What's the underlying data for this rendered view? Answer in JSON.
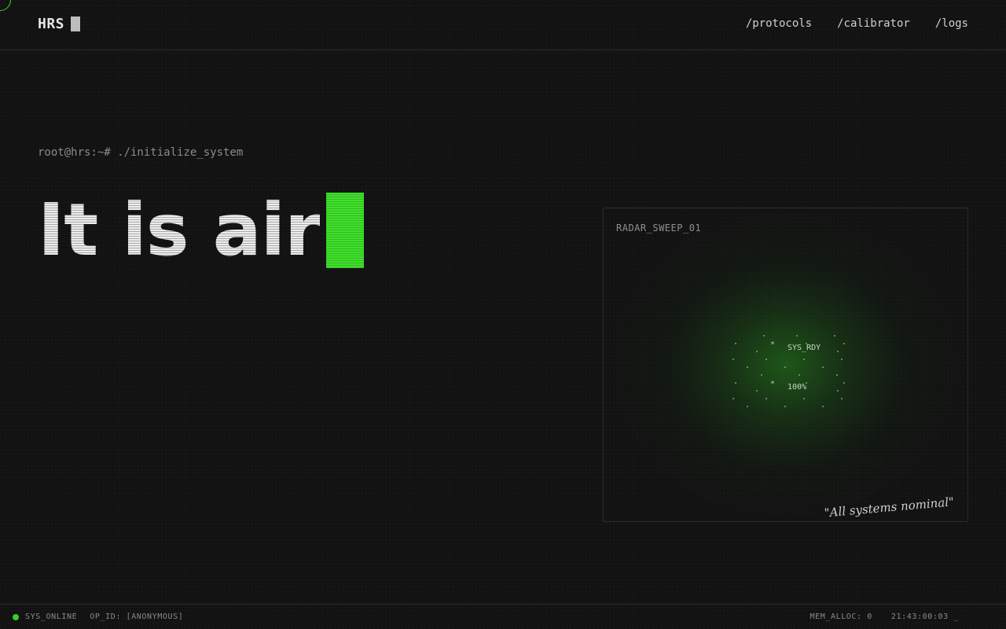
{
  "brand": {
    "name": "HRS"
  },
  "nav": {
    "items": [
      "/protocols",
      "/calibrator",
      "/logs"
    ]
  },
  "terminal": {
    "prompt": "root@hrs:~# ./initialize_system"
  },
  "hero": {
    "headline": "It is air"
  },
  "radar": {
    "label": "RADAR_SWEEP_01",
    "status_text": "SYS_RDY",
    "percent_text": "100%",
    "quote": "\"All systems nominal\""
  },
  "status": {
    "online": "SYS_ONLINE",
    "op_id": "OP_ID: [ANONYMOUS]",
    "mem": "MEM_ALLOC: 0",
    "clock": "21:43:00:03 _"
  },
  "colors": {
    "accent": "#3fe12b",
    "background": "#121212",
    "text": "#e2e2e2",
    "muted": "#8b8b8b"
  }
}
